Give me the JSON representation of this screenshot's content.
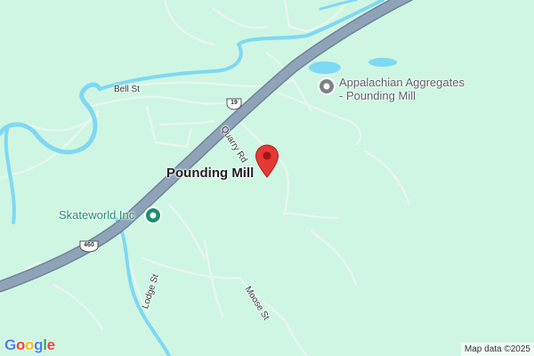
{
  "map": {
    "place_label": "Pounding Mill",
    "colors": {
      "land": "#cff5e3",
      "water": "#7fd8f2",
      "highway": "#8fa3b8",
      "road": "#e6f7ee",
      "pin": "#e53935",
      "poi_green": "#1e8e6e",
      "poi_gray": "#7c8288"
    },
    "streets": {
      "bell": "Bell St",
      "quarry": "Quarry Rd",
      "lodge": "Lodge St",
      "moose": "Moose St"
    },
    "shields": {
      "route_a": "19",
      "route_b": "460"
    },
    "pois": {
      "quarry": {
        "name_line1": "Appalachian Aggregates",
        "name_line2": "- Pounding Mill",
        "icon": "pin-circle-icon"
      },
      "rink": {
        "name": "Skateworld Inc",
        "icon": "pin-circle-icon"
      }
    },
    "marker": {
      "icon": "red-location-pin-icon"
    },
    "branding": {
      "logo": "Google",
      "logo_colors": [
        "#4285F4",
        "#EA4335",
        "#FBBC05",
        "#4285F4",
        "#34A853",
        "#EA4335"
      ]
    },
    "attribution": "Map data ©2025"
  }
}
